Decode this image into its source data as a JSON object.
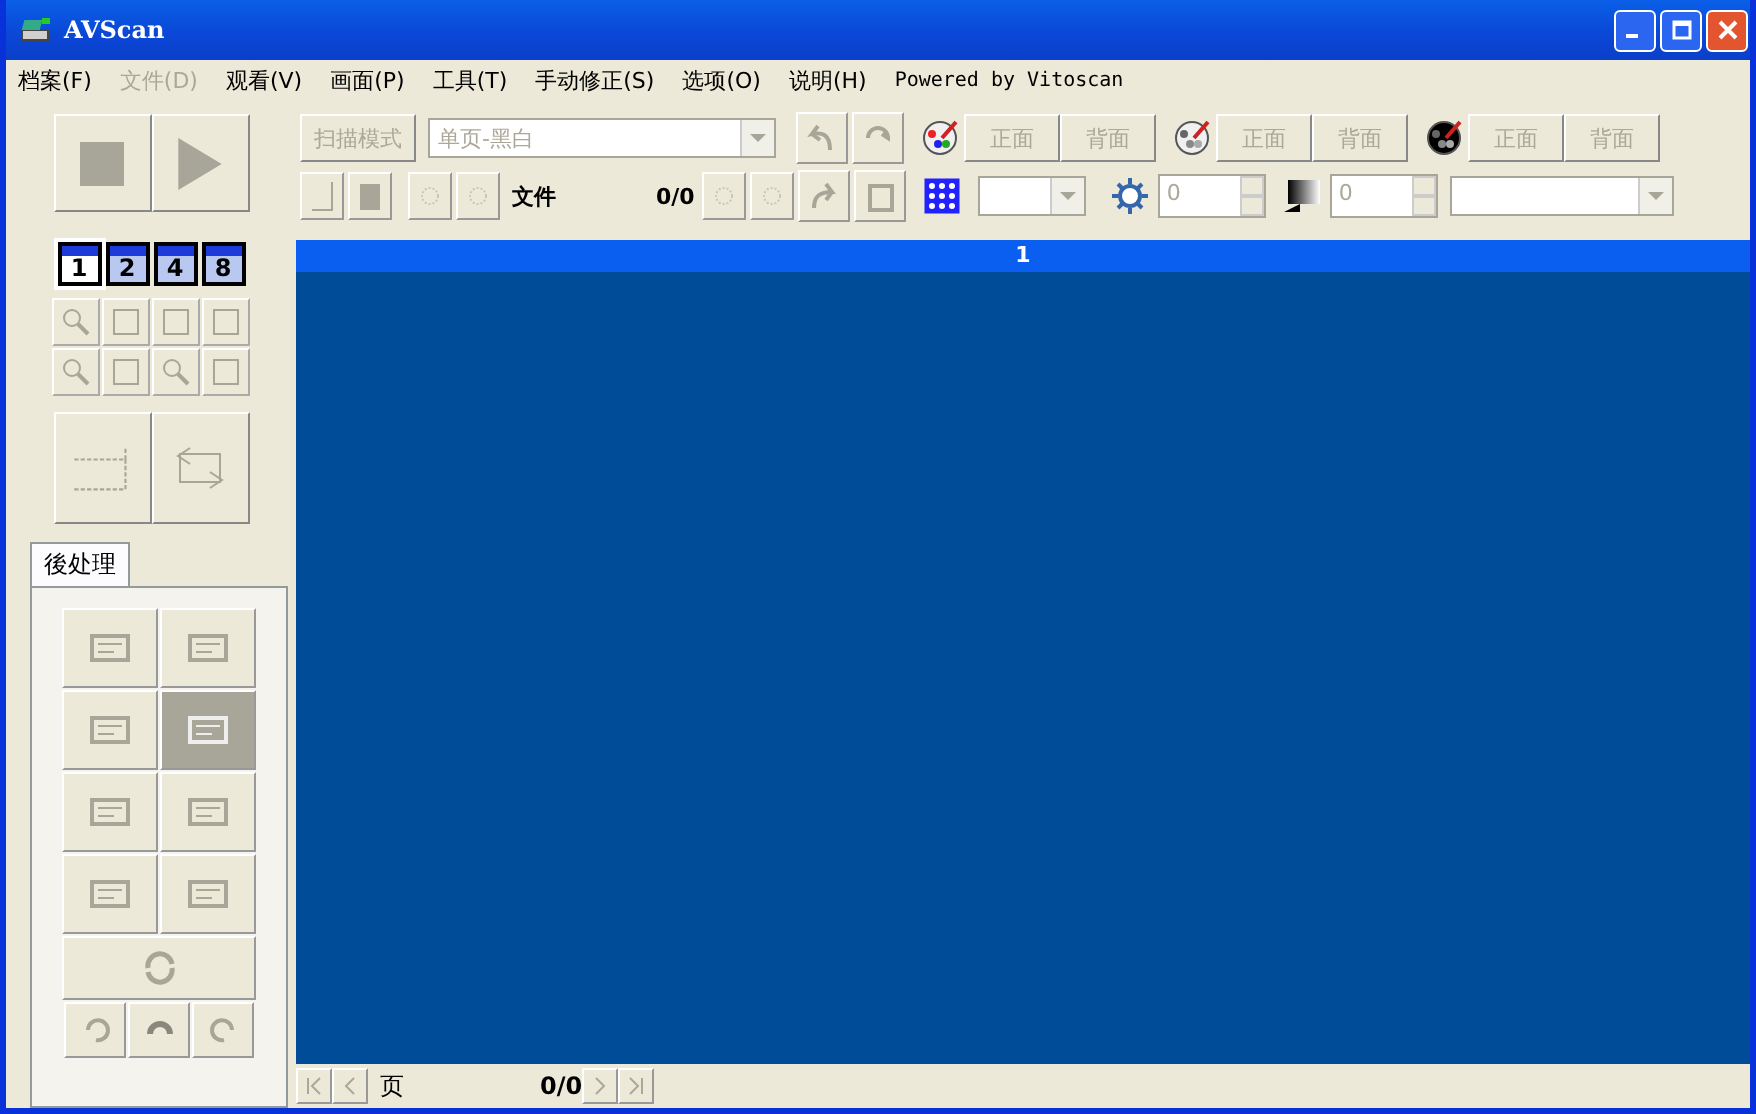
{
  "window": {
    "title": "AVScan"
  },
  "menu": [
    {
      "label": "档案(F)",
      "disabled": false
    },
    {
      "label": "文件(D)",
      "disabled": true
    },
    {
      "label": "观看(V)",
      "disabled": false
    },
    {
      "label": "画面(P)",
      "disabled": false
    },
    {
      "label": "工具(T)",
      "disabled": false
    },
    {
      "label": "手动修正(S)",
      "disabled": false
    },
    {
      "label": "选项(O)",
      "disabled": false
    },
    {
      "label": "说明(H)",
      "disabled": false
    }
  ],
  "powered_by": "Powered by Vitoscan",
  "toolbar": {
    "scan_mode_button": {
      "label": "扫描模式",
      "disabled": true
    },
    "mode_select": {
      "value": "单页-黑白"
    },
    "file_label": "文件",
    "file_count": "0/0",
    "side_groups": [
      {
        "front": "正面",
        "back": "背面",
        "disabled": true
      },
      {
        "front": "正面",
        "back": "背面",
        "disabled": true
      },
      {
        "front": "正面",
        "back": "背面",
        "disabled": true
      }
    ],
    "brightness": "0",
    "contrast": "0"
  },
  "view_tabs": [
    {
      "label": "1",
      "selected": true
    },
    {
      "label": "2",
      "selected": false
    },
    {
      "label": "4",
      "selected": false
    },
    {
      "label": "8",
      "selected": false
    }
  ],
  "panel_tab": "後处理",
  "canvas": {
    "page_header": "1"
  },
  "status": {
    "page_label": "页",
    "page_count": "0/0"
  }
}
